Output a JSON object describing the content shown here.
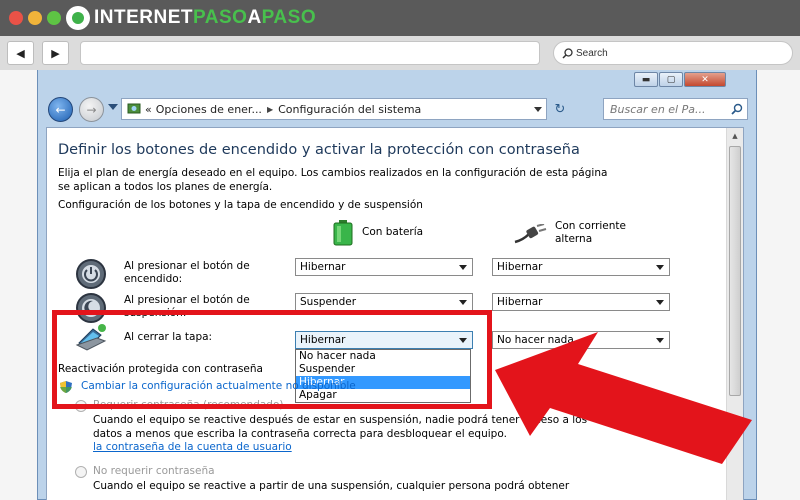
{
  "browser": {
    "logo": {
      "part1": "INTERNET",
      "part2": "PASO",
      "part3": "A",
      "part4": "PASO"
    },
    "nav": {
      "back_glyph": "◀",
      "forward_glyph": "▶"
    },
    "search": {
      "placeholder": "Search",
      "icon": "search-icon"
    }
  },
  "window": {
    "controls": {
      "minimize": "▬",
      "maximize": "▢",
      "close": "✕"
    },
    "address": {
      "back_glyph": "←",
      "forward_glyph": "→",
      "breadcrumb": [
        "Opciones de ener...",
        "Configuración del sistema"
      ],
      "sep_glyph": "▶",
      "lead_glyph": "«",
      "refresh_glyph": "↻",
      "search_placeholder": "Buscar en el Pa..."
    },
    "content": {
      "title": "Definir los botones de encendido y activar la protección con contraseña",
      "description_line1": "Elija el plan de energía deseado en el equipo. Los cambios realizados en la configuración de esta página",
      "description_line2": "se aplican a todos los planes de energía.",
      "section_heading": "Configuración de los botones y la tapa de encendido y de suspensión",
      "columns": {
        "battery": "Con batería",
        "ac_line1": "Con corriente",
        "ac_line2": "alterna"
      },
      "rows": [
        {
          "label_line1": "Al presionar el botón de",
          "label_line2": "encendido:",
          "battery": "Hibernar",
          "ac": "Hibernar",
          "icon": "power-button-icon"
        },
        {
          "label_line1": "Al presionar el botón de",
          "label_line2": "suspensión:",
          "battery": "Suspender",
          "ac": "Hibernar",
          "icon": "sleep-button-icon"
        },
        {
          "label_line1": "Al cerrar la tapa:",
          "label_line2": "",
          "battery": "Hibernar",
          "ac": "No hacer nada",
          "icon": "laptop-lid-icon"
        }
      ],
      "dropdown_options": [
        "No hacer nada",
        "Suspender",
        "Hibernar",
        "Apagar"
      ],
      "dropdown_selected": "Hibernar",
      "reactivation_heading": "Reactivación protegida con contraseña",
      "change_link": "Cambiar la configuración actualmente no disponible",
      "option1": {
        "label": "Requerir contraseña (recomendado)",
        "line1": "Cuando el equipo se reactive después de estar en suspensión, nadie podrá tener acceso a los",
        "line2": "datos a menos que escriba la contraseña correcta para desbloquear el equipo.",
        "link": "la contraseña de la cuenta de usuario"
      },
      "option2": {
        "label": "No requerir contraseña",
        "line1": "Cuando el equipo se reactive a partir de una suspensión, cualquier persona podrá obtener"
      }
    }
  },
  "colors": {
    "highlight": "#e3141b",
    "title": "#1e395b",
    "link": "#0b66cc",
    "selection": "#3399ff"
  }
}
